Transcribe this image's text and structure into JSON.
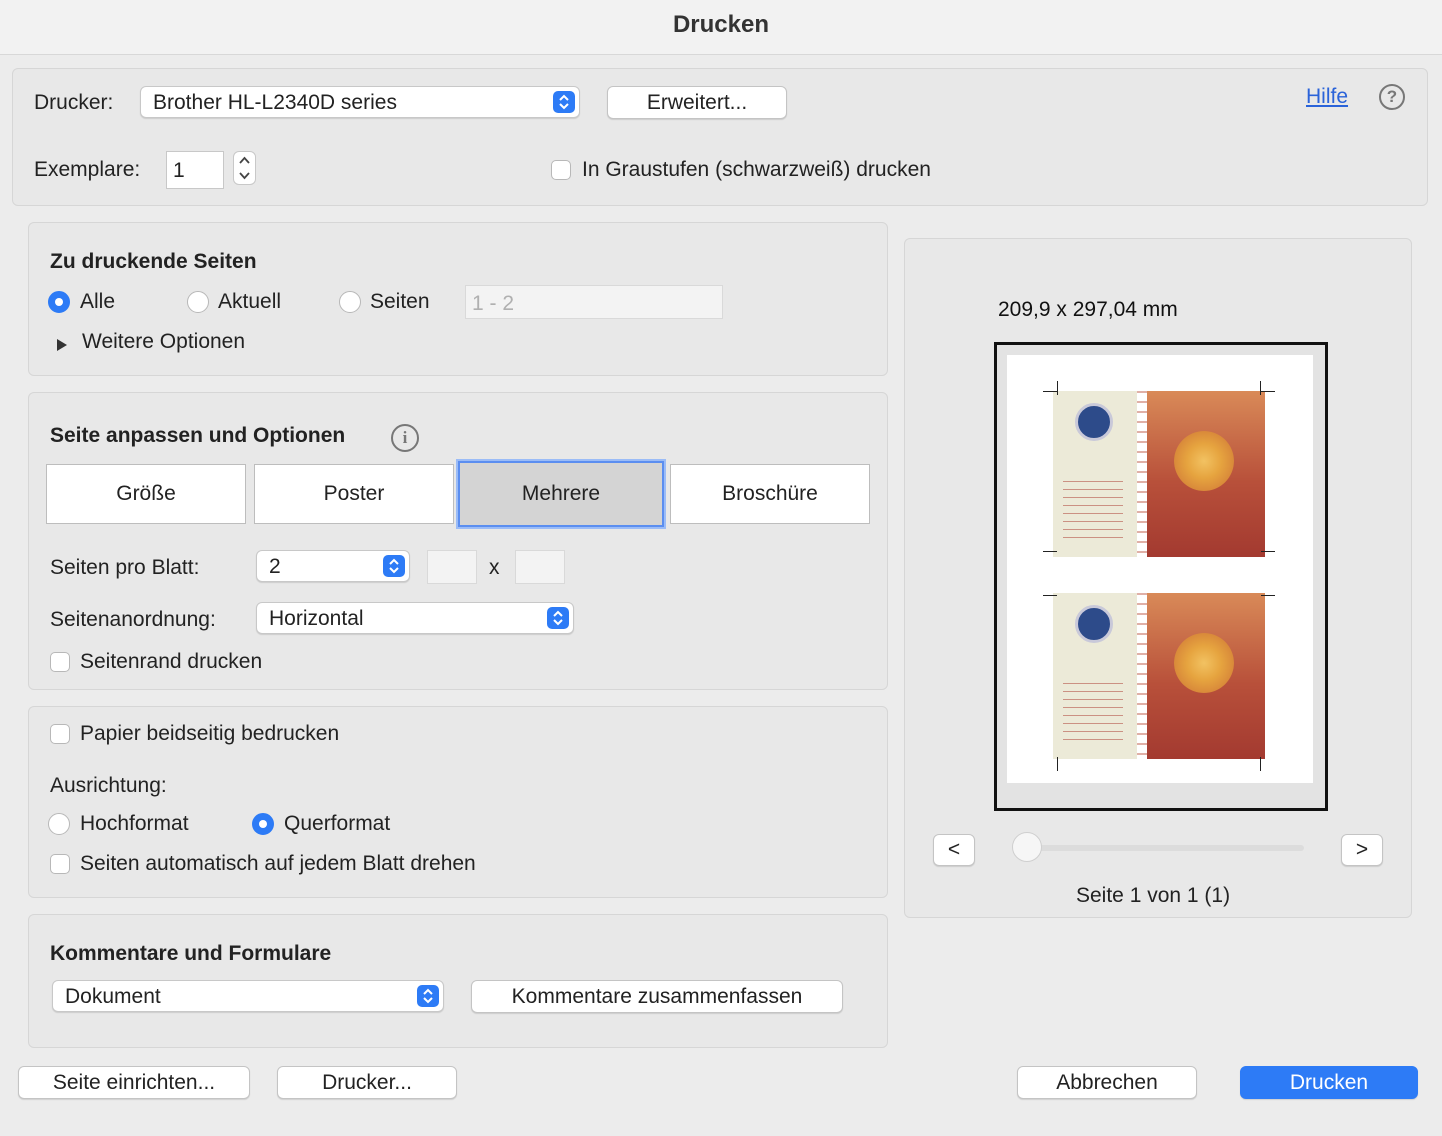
{
  "window": {
    "title": "Drucken"
  },
  "top": {
    "printer_label": "Drucker:",
    "printer_value": "Brother HL-L2340D series",
    "advanced_button": "Erweitert...",
    "help_link": "Hilfe",
    "help_icon": "?",
    "copies_label": "Exemplare:",
    "copies_value": "1",
    "grayscale_label": "In Graustufen (schwarzweiß) drucken",
    "grayscale_checked": false
  },
  "pages_section": {
    "title": "Zu druckende Seiten",
    "options": [
      {
        "label": "Alle",
        "selected": true
      },
      {
        "label": "Aktuell",
        "selected": false
      },
      {
        "label": "Seiten",
        "selected": false
      }
    ],
    "range_placeholder": "1 - 2",
    "more_options": "Weitere Optionen"
  },
  "fit_section": {
    "title": "Seite anpassen und Optionen",
    "info_icon": "i",
    "tabs": [
      {
        "label": "Größe",
        "active": false
      },
      {
        "label": "Poster",
        "active": false
      },
      {
        "label": "Mehrere",
        "active": true
      },
      {
        "label": "Broschüre",
        "active": false
      }
    ],
    "pages_per_sheet_label": "Seiten pro Blatt:",
    "pages_per_sheet_value": "2",
    "times": "x",
    "order_label": "Seitenanordnung:",
    "order_value": "Horizontal",
    "print_border_label": "Seitenrand drucken",
    "print_border_checked": false
  },
  "duplex_section": {
    "duplex_label": "Papier beidseitig bedrucken",
    "duplex_checked": false,
    "orientation_label": "Ausrichtung:",
    "portrait_label": "Hochformat",
    "landscape_label": "Querformat",
    "landscape_selected": true,
    "autorotate_label": "Seiten automatisch auf jedem Blatt drehen",
    "autorotate_checked": false
  },
  "comments_section": {
    "title": "Kommentare und Formulare",
    "select_value": "Dokument",
    "summarize_button": "Kommentare zusammenfassen"
  },
  "preview": {
    "dimensions": "209,9 x 297,04 mm",
    "prev_button": "<",
    "next_button": ">",
    "page_indicator": "Seite 1 von 1 (1)",
    "slider_position": 0
  },
  "footer": {
    "page_setup_button": "Seite einrichten...",
    "printer_button": "Drucker...",
    "cancel_button": "Abbrechen",
    "print_button": "Drucken"
  },
  "colors": {
    "accent": "#2d7bf6",
    "print_button": "#2d7bf6"
  }
}
